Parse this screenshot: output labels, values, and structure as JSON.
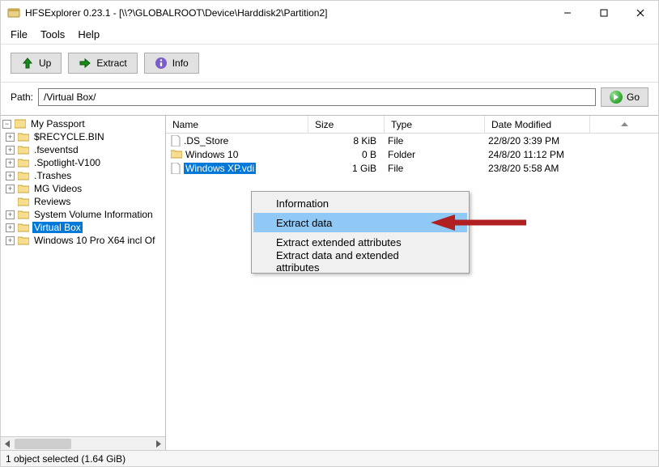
{
  "window": {
    "title": "HFSExplorer 0.23.1 - [\\\\?\\GLOBALROOT\\Device\\Harddisk2\\Partition2]"
  },
  "menu": {
    "file": "File",
    "tools": "Tools",
    "help": "Help"
  },
  "toolbar": {
    "up": "Up",
    "extract": "Extract",
    "info": "Info"
  },
  "path": {
    "label": "Path:",
    "value": "/Virtual Box/",
    "go": "Go"
  },
  "tree": {
    "root": "My Passport",
    "items": [
      "$RECYCLE.BIN",
      ".fseventsd",
      ".Spotlight-V100",
      ".Trashes",
      "MG Videos",
      "Reviews",
      "System Volume Information",
      "Virtual Box",
      "Windows 10 Pro X64 incl Of"
    ],
    "selected_index": 7
  },
  "list": {
    "columns": {
      "name": "Name",
      "size": "Size",
      "type": "Type",
      "date": "Date Modified"
    },
    "rows": [
      {
        "name": ".DS_Store",
        "size": "8 KiB",
        "type": "File",
        "date": "22/8/20 3:39 PM",
        "icon": "file"
      },
      {
        "name": "Windows 10",
        "size": "0 B",
        "type": "Folder",
        "date": "24/8/20 11:12 PM",
        "icon": "folder"
      },
      {
        "name": "Windows XP.vdi",
        "size": "1 GiB",
        "type": "File",
        "date": "23/8/20 5:58 AM",
        "icon": "file"
      }
    ],
    "selected_index": 2
  },
  "context_menu": {
    "items": [
      "Information",
      "Extract data",
      "Extract extended attributes",
      "Extract data and extended attributes"
    ],
    "hover_index": 1
  },
  "status": "1 object selected (1.64 GiB)"
}
